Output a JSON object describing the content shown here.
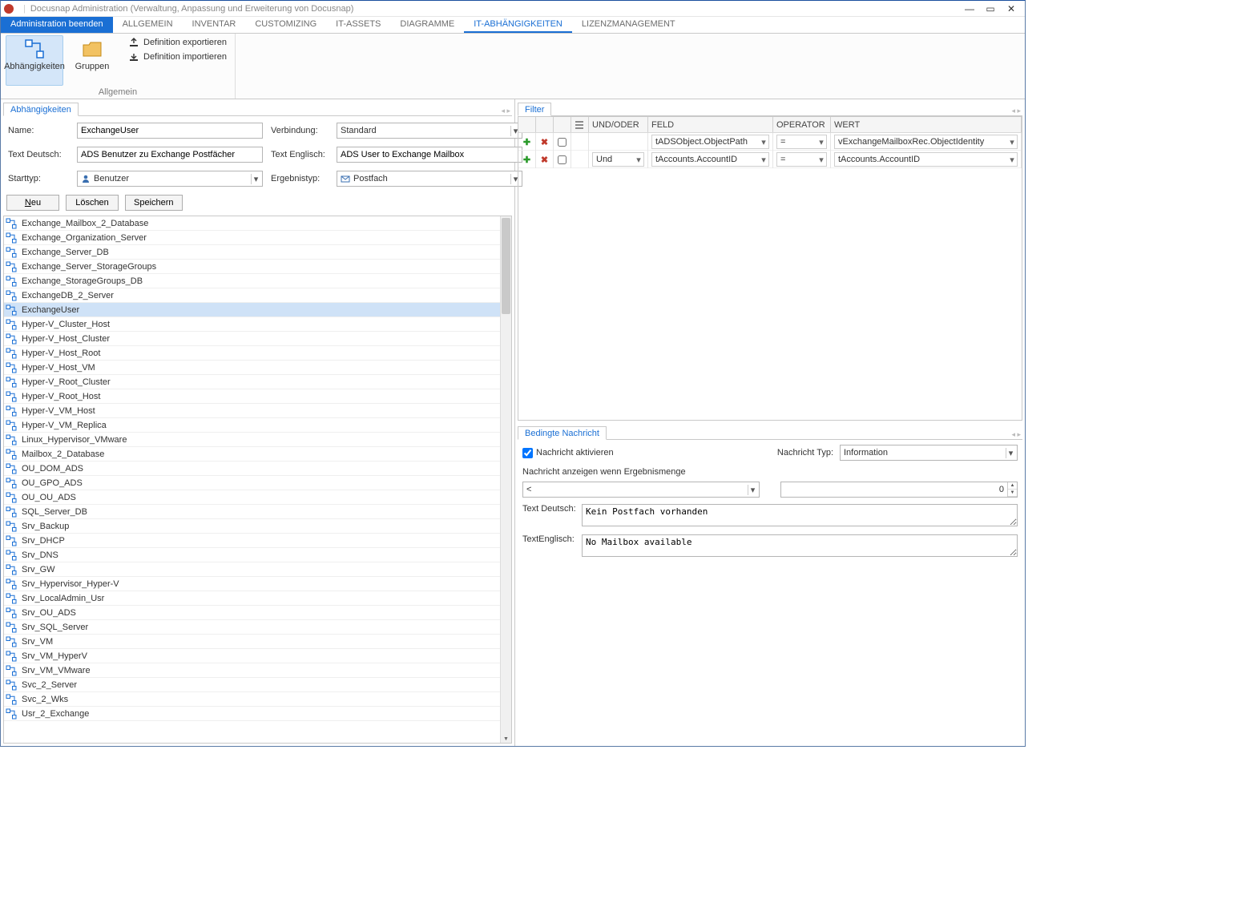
{
  "window": {
    "title": "Docusnap Administration (Verwaltung, Anpassung und Erweiterung von Docusnap)"
  },
  "menubar": {
    "primary": "Administration beenden",
    "tabs": [
      "ALLGEMEIN",
      "INVENTAR",
      "CUSTOMIZING",
      "IT-ASSETS",
      "DIAGRAMME",
      "IT-ABHÄNGIGKEITEN",
      "LIZENZMANAGEMENT"
    ],
    "activeIndex": 5
  },
  "ribbon": {
    "group_label": "Allgemein",
    "big_buttons": [
      {
        "label": "Abhängigkeiten",
        "selected": true
      },
      {
        "label": "Gruppen",
        "selected": false
      }
    ],
    "side_buttons": [
      {
        "label": "Definition exportieren"
      },
      {
        "label": "Definition importieren"
      }
    ]
  },
  "leftPanel": {
    "tab": "Abhängigkeiten",
    "labels": {
      "name": "Name:",
      "verbindung": "Verbindung:",
      "text_de": "Text Deutsch:",
      "text_en": "Text Englisch:",
      "starttyp": "Starttyp:",
      "ergebnistyp": "Ergebnistyp:"
    },
    "values": {
      "name": "ExchangeUser",
      "verbindung": "Standard",
      "text_de": "ADS Benutzer zu Exchange Postfächer",
      "text_en": "ADS User to Exchange Mailbox",
      "starttyp": "Benutzer",
      "ergebnistyp": "Postfach"
    },
    "buttons": {
      "neu_prefix": "N",
      "neu_rest": "eu",
      "loeschen": "Löschen",
      "speichern": "Speichern"
    },
    "list": [
      "Exchange_Mailbox_2_Database",
      "Exchange_Organization_Server",
      "Exchange_Server_DB",
      "Exchange_Server_StorageGroups",
      "Exchange_StorageGroups_DB",
      "ExchangeDB_2_Server",
      "ExchangeUser",
      "Hyper-V_Cluster_Host",
      "Hyper-V_Host_Cluster",
      "Hyper-V_Host_Root",
      "Hyper-V_Host_VM",
      "Hyper-V_Root_Cluster",
      "Hyper-V_Root_Host",
      "Hyper-V_VM_Host",
      "Hyper-V_VM_Replica",
      "Linux_Hypervisor_VMware",
      "Mailbox_2_Database",
      "OU_DOM_ADS",
      "OU_GPO_ADS",
      "OU_OU_ADS",
      "SQL_Server_DB",
      "Srv_Backup",
      "Srv_DHCP",
      "Srv_DNS",
      "Srv_GW",
      "Srv_Hypervisor_Hyper-V",
      "Srv_LocalAdmin_Usr",
      "Srv_OU_ADS",
      "Srv_SQL_Server",
      "Srv_VM",
      "Srv_VM_HyperV",
      "Srv_VM_VMware",
      "Svc_2_Server",
      "Svc_2_Wks",
      "Usr_2_Exchange"
    ],
    "selectedIndex": 6
  },
  "filter": {
    "tab": "Filter",
    "headers": {
      "undoder": "UND/ODER",
      "feld": "FELD",
      "operator": "OPERATOR",
      "wert": "WERT"
    },
    "rows": [
      {
        "undoder": "",
        "feld": "tADSObject.ObjectPath",
        "operator": "=",
        "wert": "vExchangeMailboxRec.ObjectIdentity"
      },
      {
        "undoder": "Und",
        "feld": "tAccounts.AccountID",
        "operator": "=",
        "wert": "tAccounts.AccountID"
      }
    ]
  },
  "cond": {
    "tab": "Bedingte Nachricht",
    "activate_label": "Nachricht aktivieren",
    "typ_label": "Nachricht Typ:",
    "typ_value": "Information",
    "show_when_label": "Nachricht anzeigen wenn Ergebnismenge",
    "comparator": "<",
    "threshold": "0",
    "text_de_label": "Text Deutsch:",
    "text_de_value": "Kein Postfach vorhanden",
    "text_en_label": "TextEnglisch:",
    "text_en_value": "No Mailbox available"
  }
}
